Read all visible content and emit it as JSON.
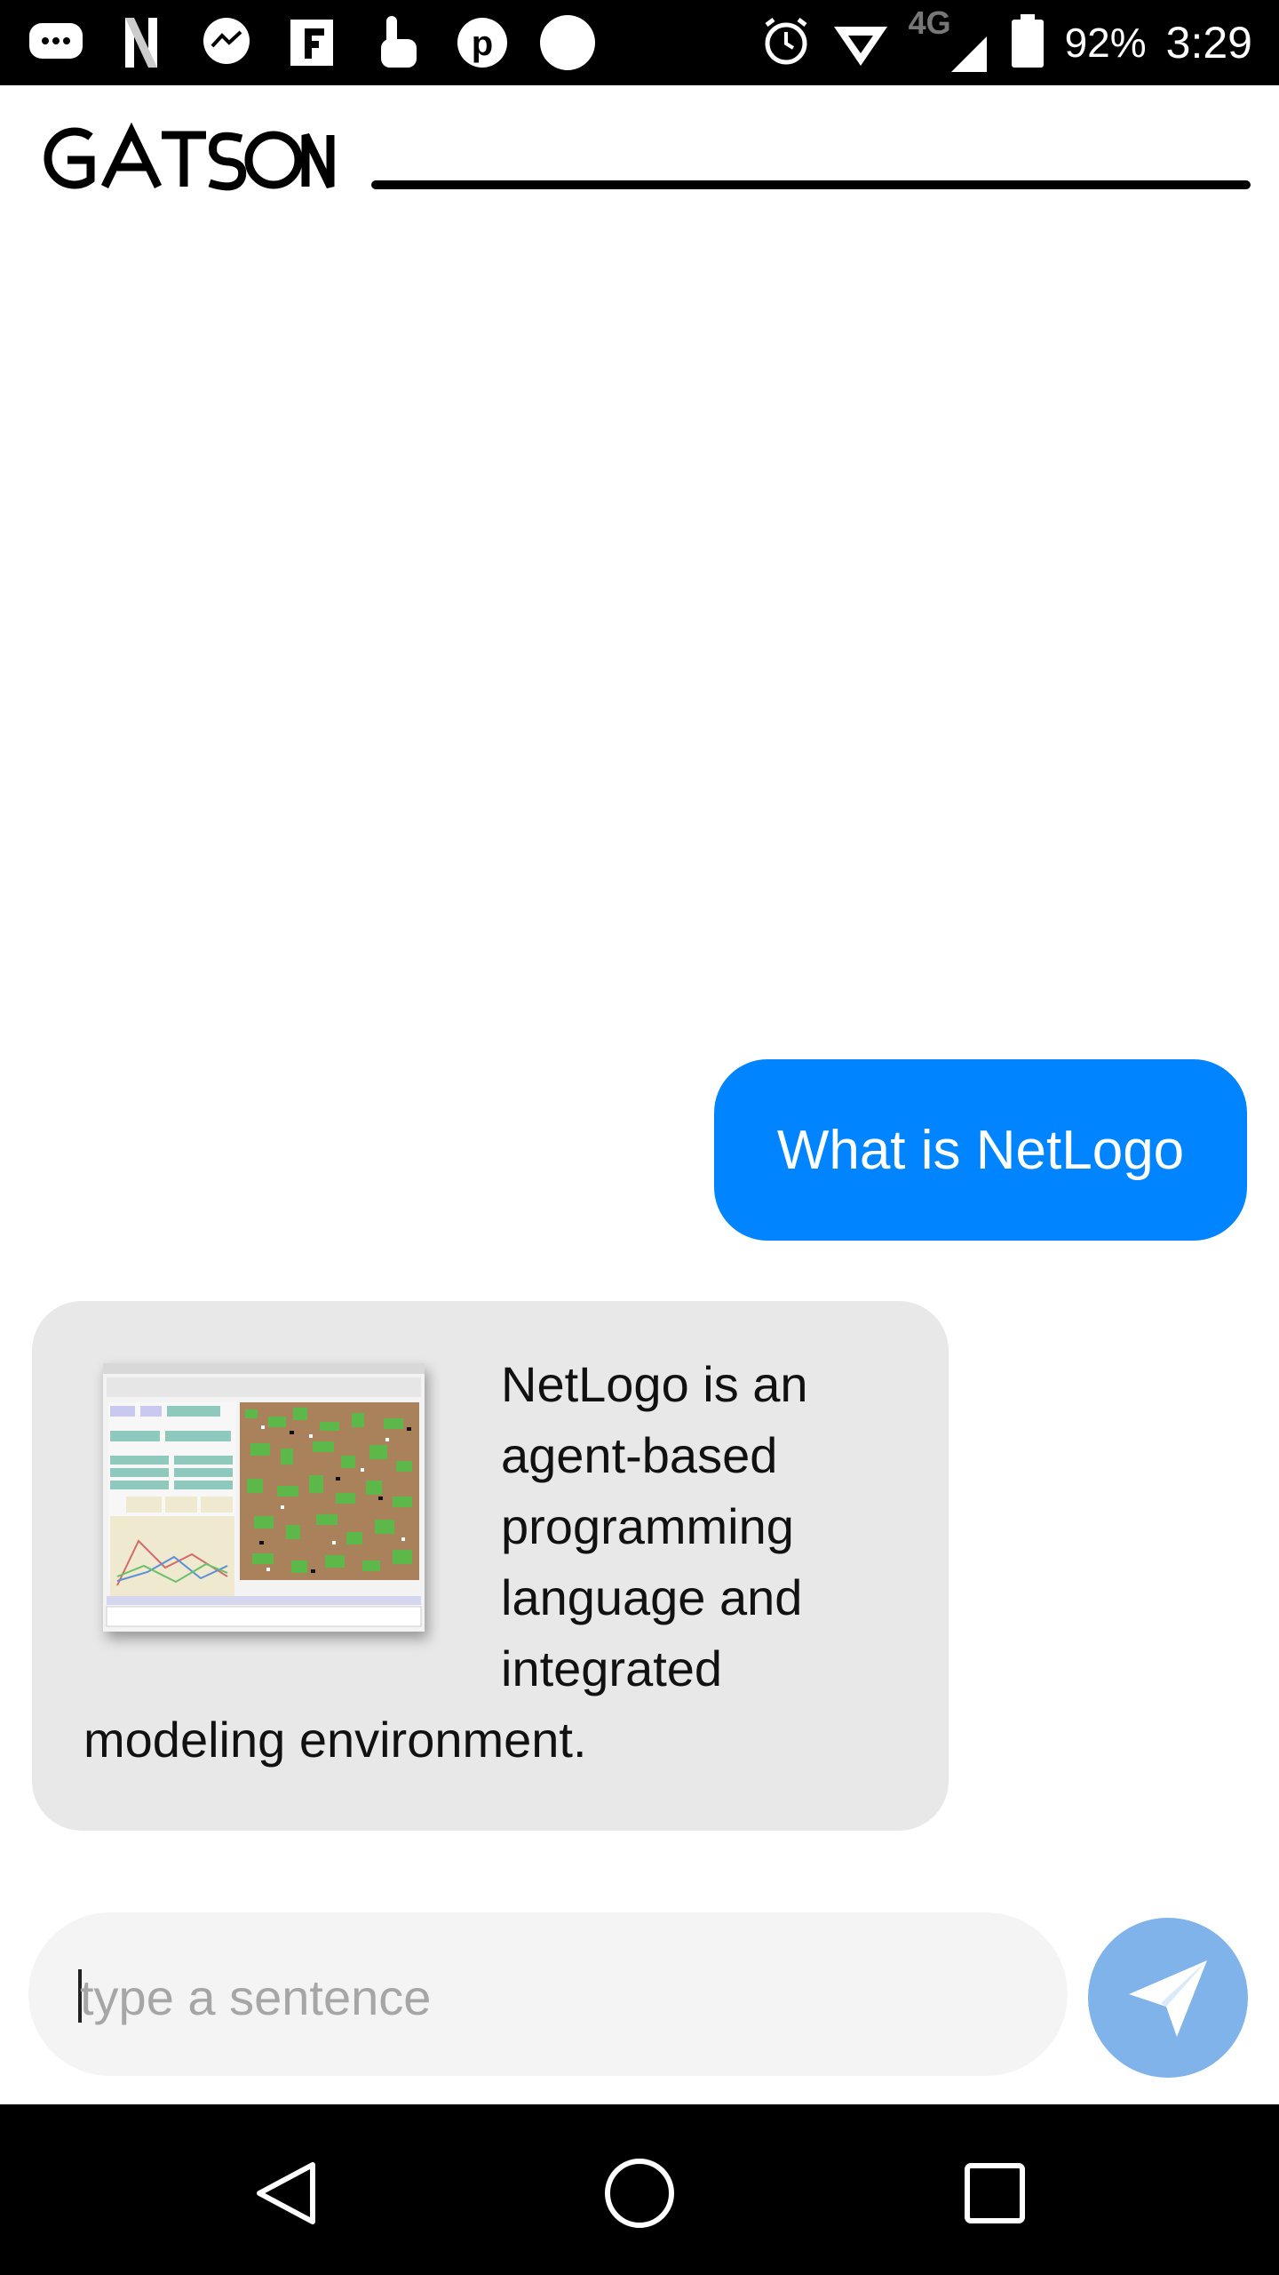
{
  "status_bar": {
    "battery": "92%",
    "time": "3:29",
    "network": "4G",
    "icons": [
      "messages-icon",
      "netflix-icon",
      "messenger-icon",
      "flipboard-icon",
      "touch-icon",
      "pinterest-icon",
      "circle-icon",
      "alarm-icon",
      "wifi-icon",
      "signal-icon",
      "battery-icon"
    ]
  },
  "header": {
    "app_name": "GATSON"
  },
  "chat": {
    "messages": [
      {
        "sender": "user",
        "text": "What is NetLogo"
      },
      {
        "sender": "bot",
        "lines": [
          "NetLogo is an",
          "agent-based",
          "programming",
          "language and",
          "integrated",
          "modeling environment."
        ],
        "image": "netlogo-screenshot"
      }
    ]
  },
  "input": {
    "placeholder": "type a sentence",
    "value": ""
  },
  "send": {
    "icon": "send-icon"
  },
  "nav": {
    "icons": [
      "back-icon",
      "home-icon",
      "recents-icon"
    ]
  },
  "colors": {
    "user_bubble": "#0084ff",
    "bot_bubble": "#e8e8e8",
    "send_button": "#7fb3ea"
  }
}
